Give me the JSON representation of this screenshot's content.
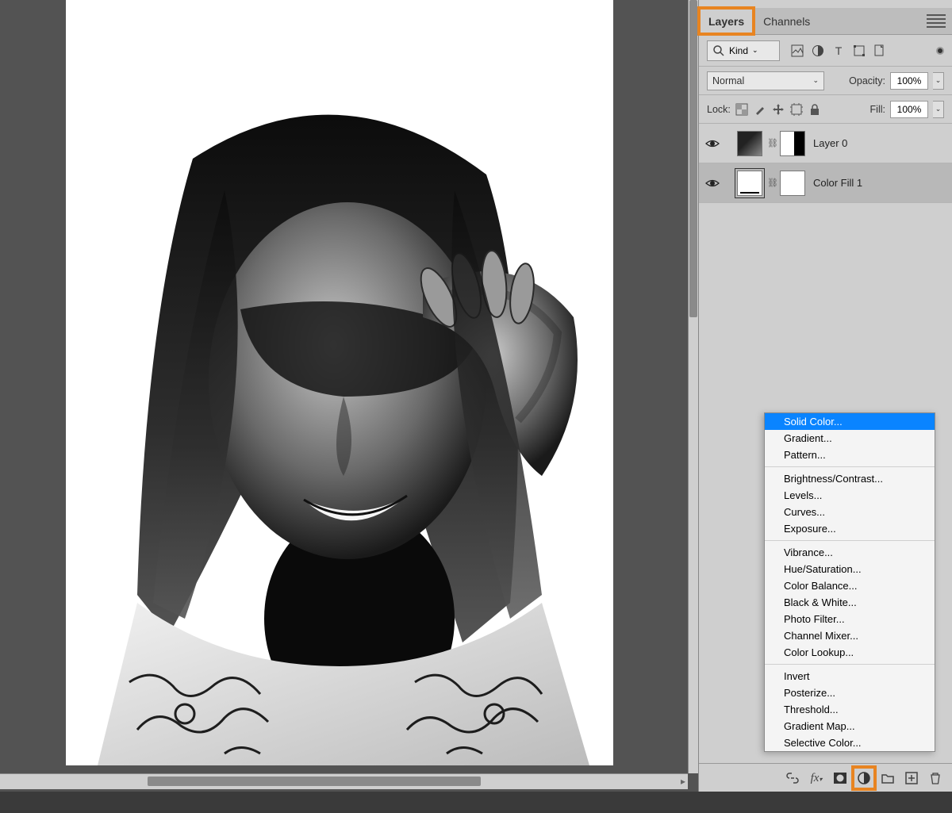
{
  "tabs": {
    "layers": "Layers",
    "channels": "Channels"
  },
  "filter": {
    "kind": "Kind"
  },
  "blend": {
    "mode": "Normal",
    "opacity_label": "Opacity:",
    "opacity": "100%"
  },
  "lock": {
    "label": "Lock:",
    "fill_label": "Fill:",
    "fill": "100%"
  },
  "layers": [
    {
      "name": "Layer 0"
    },
    {
      "name": "Color Fill 1"
    }
  ],
  "popup": {
    "groups": [
      [
        "Solid Color...",
        "Gradient...",
        "Pattern..."
      ],
      [
        "Brightness/Contrast...",
        "Levels...",
        "Curves...",
        "Exposure..."
      ],
      [
        "Vibrance...",
        "Hue/Saturation...",
        "Color Balance...",
        "Black & White...",
        "Photo Filter...",
        "Channel Mixer...",
        "Color Lookup..."
      ],
      [
        "Invert",
        "Posterize...",
        "Threshold...",
        "Gradient Map...",
        "Selective Color..."
      ]
    ],
    "selected": "Solid Color..."
  }
}
